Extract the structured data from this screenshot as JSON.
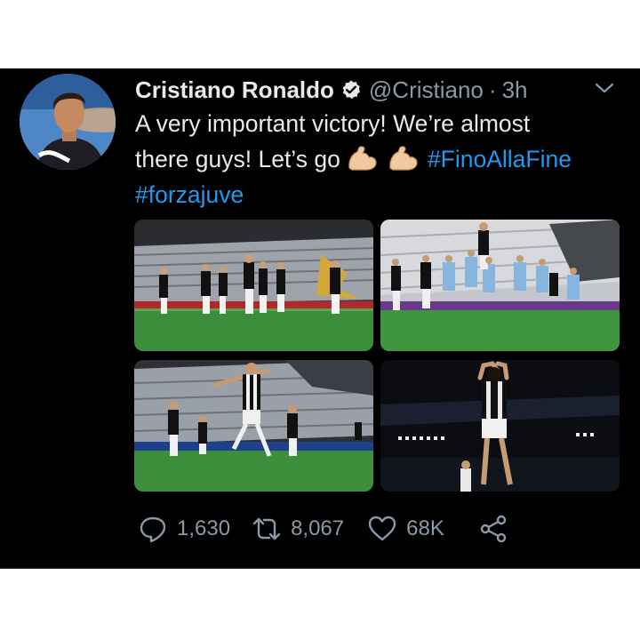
{
  "tweet": {
    "author_name": "Cristiano Ronaldo",
    "handle": "@Cristiano",
    "separator": "·",
    "time": "3h",
    "text_line1": "A very important victory! We’re almost",
    "text_line2_prefix": "there guys! Let’s go",
    "hashtag1": "#FinoAllaFine",
    "hashtag2": "#forzajuve",
    "emoji": "flexed-biceps x2",
    "icons": {
      "verified": "verified-badge-icon",
      "menu": "chevron-down-icon",
      "reply": "reply-icon",
      "retweet": "retweet-icon",
      "like": "heart-icon",
      "share": "share-icon"
    },
    "photos": [
      {
        "name": "juventus-players-celebrating-wide"
      },
      {
        "name": "free-kick-wall-jump"
      },
      {
        "name": "player-celebrating-arms-out"
      },
      {
        "name": "player-number-7-hands-on-head"
      }
    ]
  },
  "actions": {
    "replies": "1,630",
    "retweets": "8,067",
    "likes": "68K"
  },
  "colors": {
    "background": "#000000",
    "text": "#e7e9ea",
    "muted": "#8b98a5",
    "link": "#1d9bf0"
  }
}
